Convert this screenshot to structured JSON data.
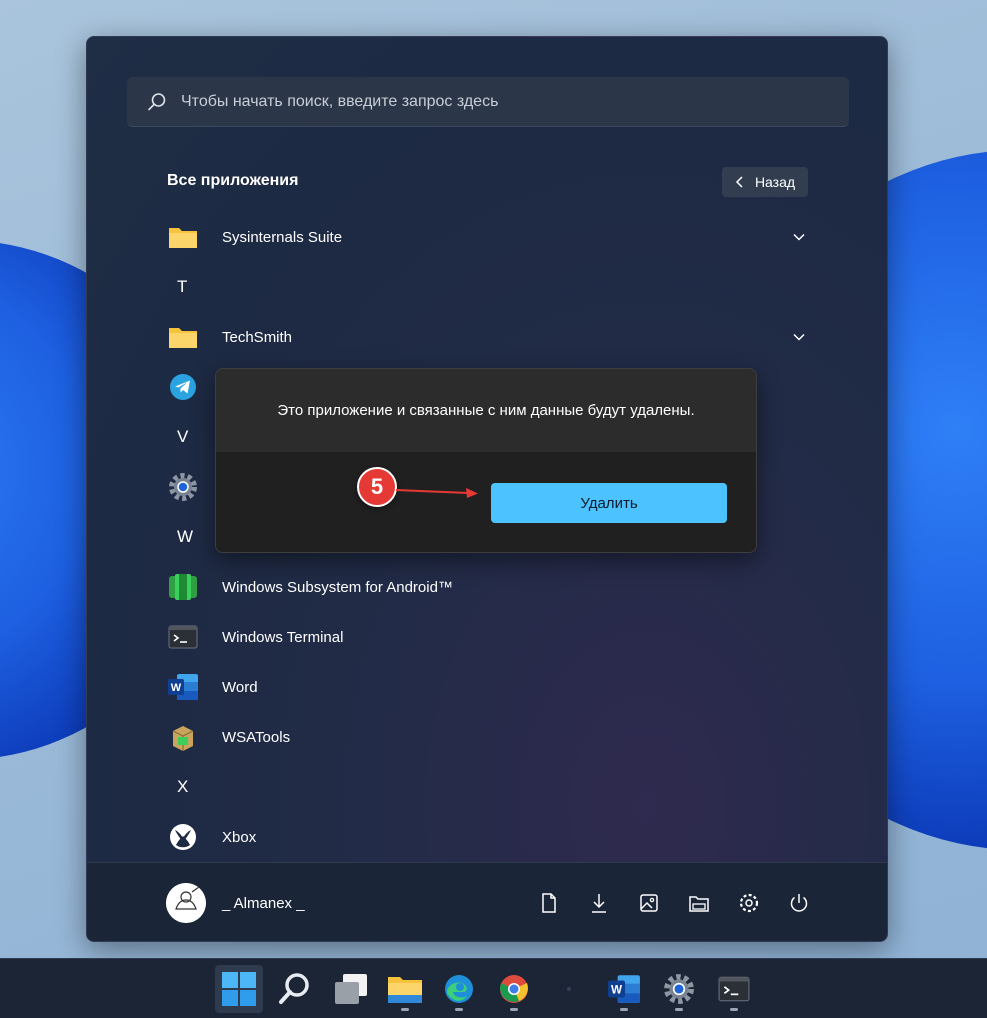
{
  "search": {
    "placeholder": "Чтобы начать поиск, введите запрос здесь"
  },
  "all_apps": {
    "title": "Все приложения",
    "back_label": "Назад"
  },
  "apps": [
    {
      "type": "app",
      "label": "Sysinternals Suite",
      "icon": "folder-icon",
      "expandable": true
    },
    {
      "type": "letter",
      "label": "T"
    },
    {
      "type": "app",
      "label": "TechSmith",
      "icon": "folder-icon",
      "expandable": true
    },
    {
      "type": "app",
      "label": "",
      "icon": "telegram-icon"
    },
    {
      "type": "letter",
      "label": "V"
    },
    {
      "type": "app",
      "label": "",
      "icon": "gear-icon"
    },
    {
      "type": "letter",
      "label": "W"
    },
    {
      "type": "app",
      "label": "Windows Subsystem for Android™",
      "icon": "android-subsystem-icon"
    },
    {
      "type": "app",
      "label": "Windows Terminal",
      "icon": "terminal-icon"
    },
    {
      "type": "app",
      "label": "Word",
      "icon": "word-icon"
    },
    {
      "type": "app",
      "label": "WSATools",
      "icon": "package-icon"
    },
    {
      "type": "letter",
      "label": "X"
    },
    {
      "type": "app",
      "label": "Xbox",
      "icon": "xbox-icon"
    }
  ],
  "dialog": {
    "message": "Это приложение и связанные с ним данные будут удалены.",
    "delete_label": "Удалить"
  },
  "annotation": {
    "step": "5"
  },
  "footer": {
    "username": "_ Almanex _",
    "icons": [
      "document-icon",
      "download-icon",
      "image-icon",
      "file-explorer-icon",
      "settings-icon",
      "power-icon"
    ]
  },
  "taskbar": {
    "items": [
      "start-icon",
      "search-icon",
      "task-view-icon",
      "file-explorer-icon",
      "edge-icon",
      "chrome-icon",
      "app-icon",
      "word-icon",
      "settings-icon",
      "terminal-icon"
    ]
  },
  "colors": {
    "accent": "#4cc2ff",
    "badge": "#e53935",
    "folder": "#f8c33c"
  }
}
